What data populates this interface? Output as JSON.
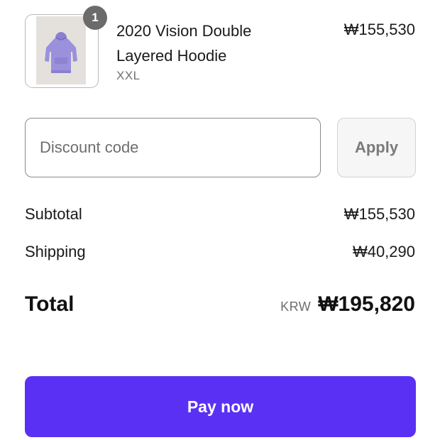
{
  "product": {
    "quantity": "1",
    "name": "2020 Vision Double Layered Hoodie",
    "variant": "XXL",
    "price": "₩155,530",
    "image_icon": "hoodie-image"
  },
  "discount": {
    "placeholder": "Discount code",
    "value": "",
    "apply_label": "Apply"
  },
  "summary": {
    "subtotal_label": "Subtotal",
    "subtotal_value": "₩155,530",
    "shipping_label": "Shipping",
    "shipping_value": "₩40,290",
    "total_label": "Total",
    "currency_code": "KRW",
    "total_value": "₩195,820"
  },
  "actions": {
    "pay_label": "Pay now"
  },
  "colors": {
    "pay_button": "#5a31f4",
    "badge": "#6b6b6b",
    "hoodie": "#9b90dc"
  }
}
